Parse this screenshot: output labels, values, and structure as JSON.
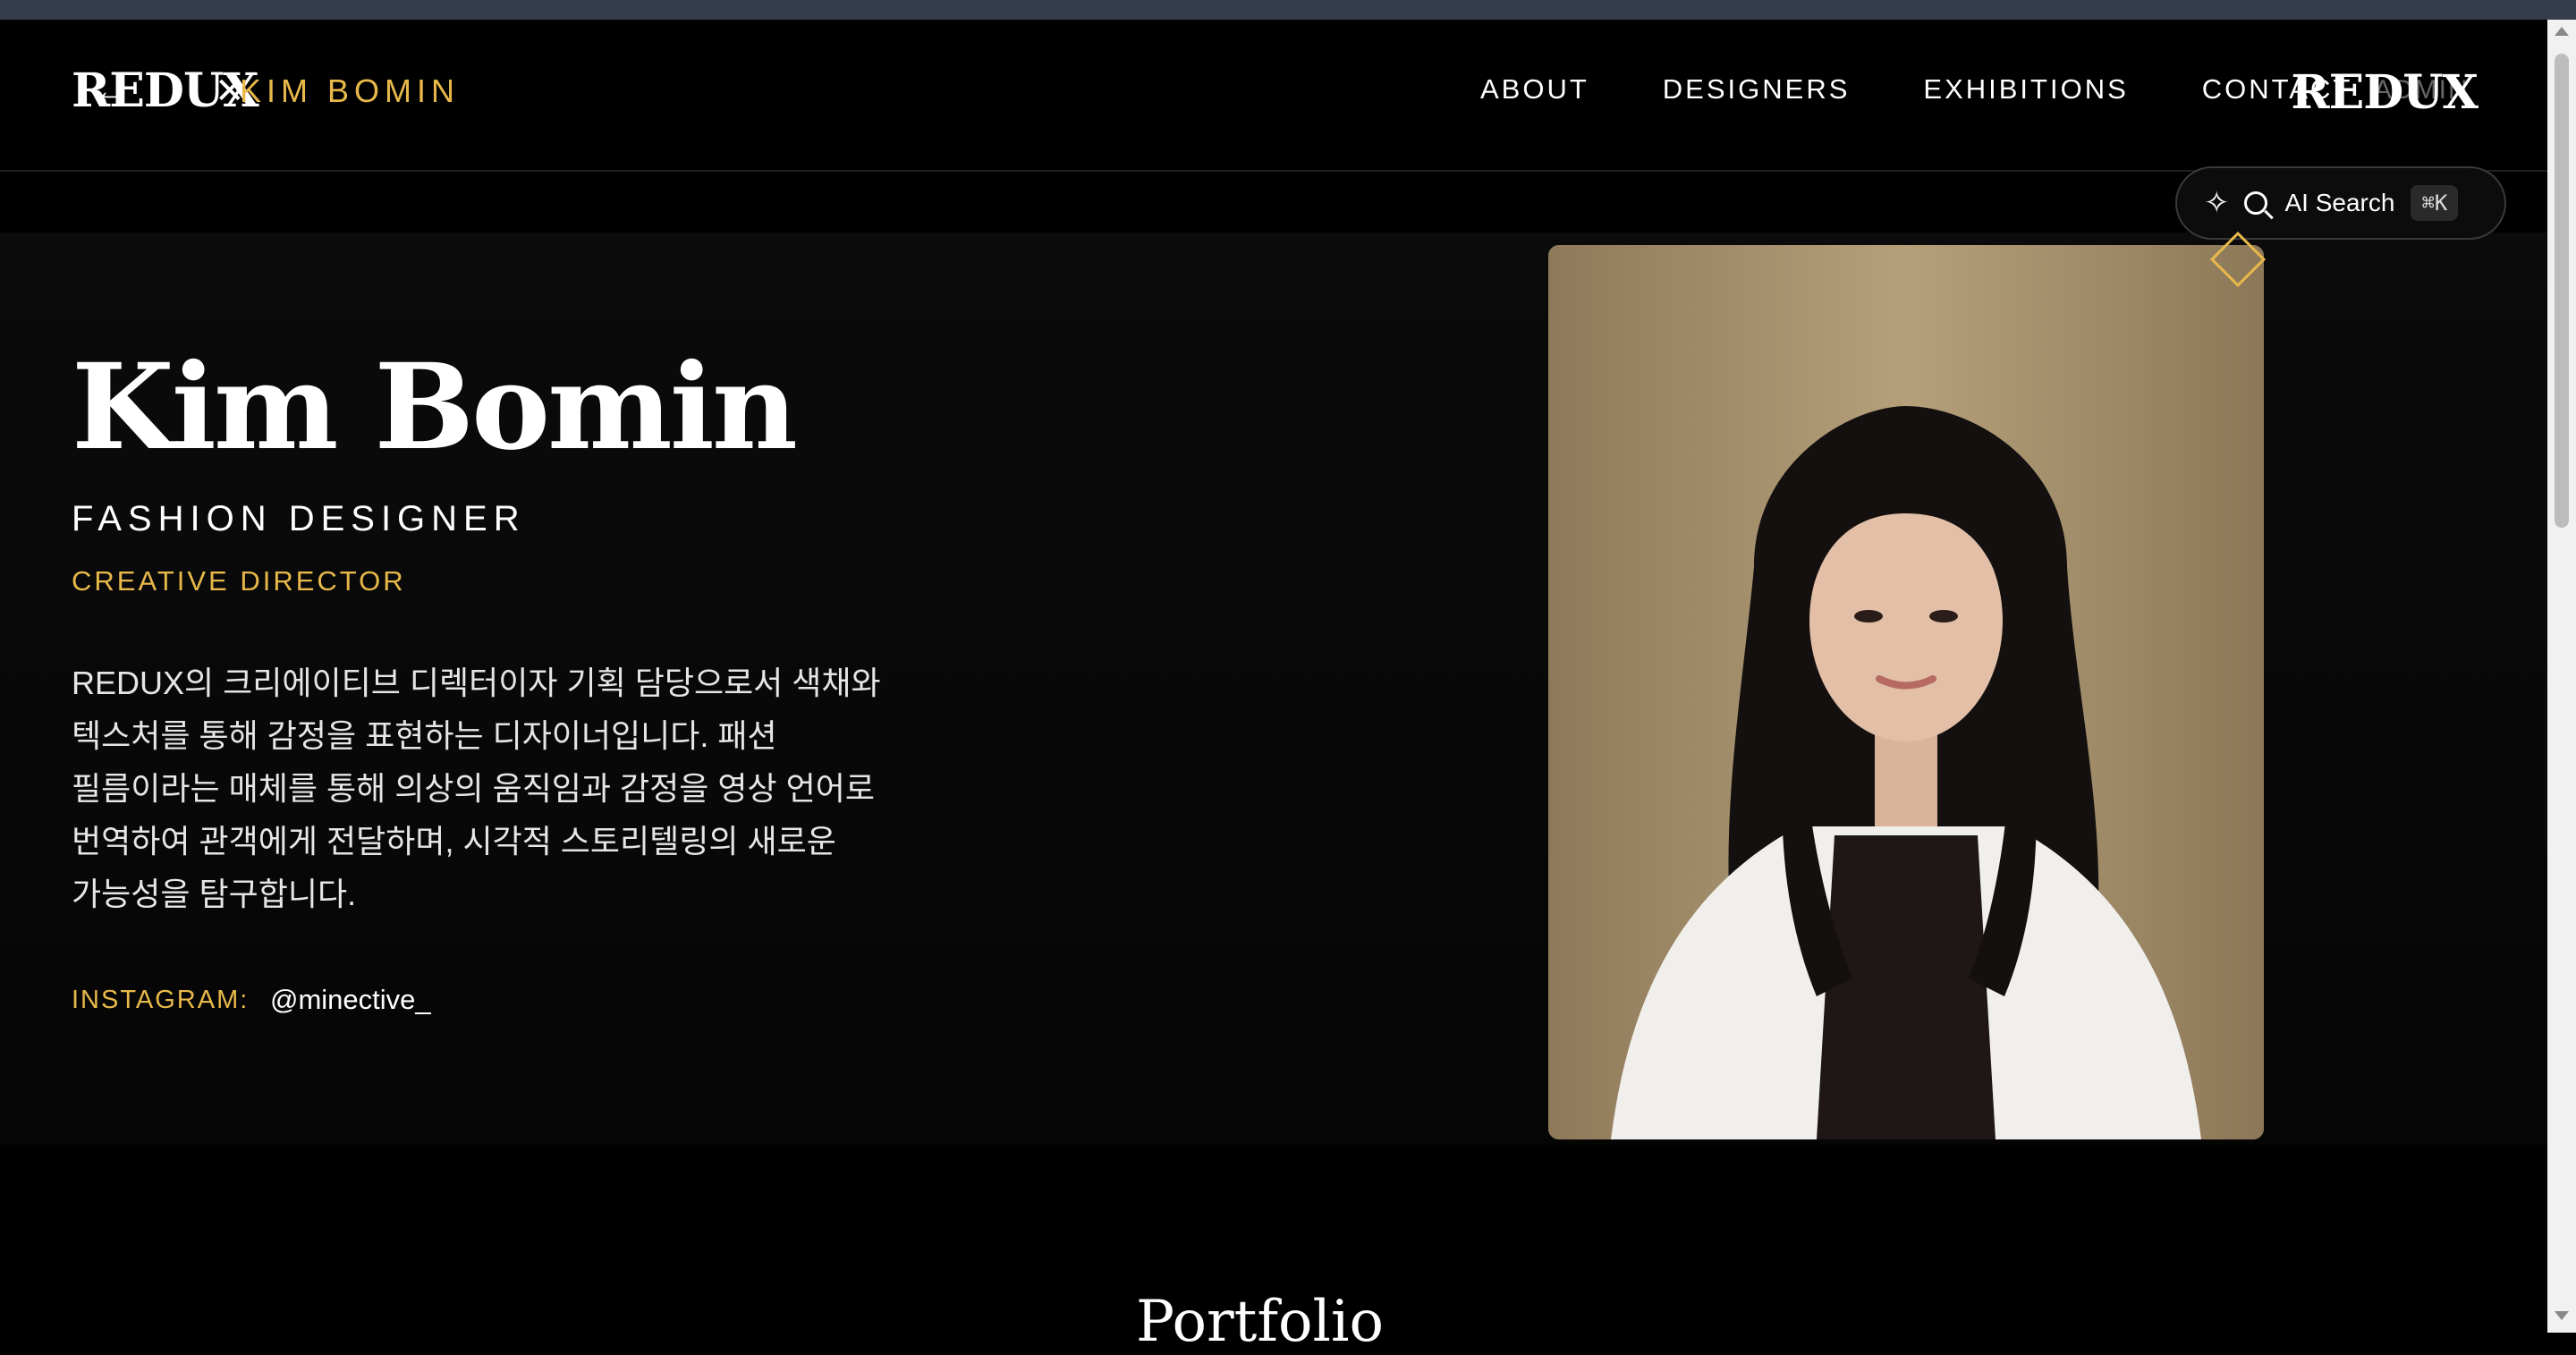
{
  "header": {
    "logo": "REDUX",
    "back_arrow": "←",
    "close_x": "✕",
    "breadcrumb": "KIM BOMIN",
    "nav": [
      "ABOUT",
      "DESIGNERS",
      "EXHIBITIONS",
      "CONTACT"
    ],
    "admin": "ADMIN",
    "logo_right": "REDUX"
  },
  "ai_search": {
    "label": "AI Search",
    "shortcut": "⌘K"
  },
  "designer": {
    "name": "Kim Bomin",
    "role": "FASHION DESIGNER",
    "subrole": "CREATIVE DIRECTOR",
    "bio": "REDUX의 크리에이티브 디렉터이자 기획 담당으로서 색채와\n텍스처를 통해 감정을 표현하는 디자이너입니다. 패션\n필름이라는 매체를 통해 의상의 움직임과 감정을 영상 언어로\n번역하여 관객에게 전달하며, 시각적 스토리텔링의 새로운\n가능성을 탐구합니다.",
    "instagram_label": "INSTAGRAM:",
    "instagram_handle": "@minective_"
  },
  "section": {
    "portfolio_title": "Portfolio"
  },
  "colors": {
    "accent": "#e8b94a",
    "background": "#000000",
    "text": "#ffffff"
  }
}
